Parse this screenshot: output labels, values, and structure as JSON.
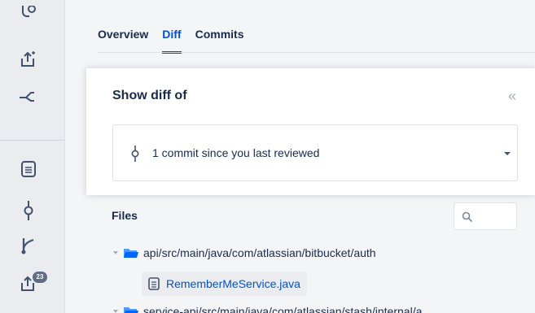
{
  "tabs": [
    {
      "label": "Overview"
    },
    {
      "label": "Diff"
    },
    {
      "label": "Commits"
    }
  ],
  "sidebar": {
    "icons": [
      "pin-icon",
      "share-icon",
      "merge-icon",
      "document-icon",
      "commit-icon",
      "branch-icon",
      "share-badge-icon"
    ],
    "badge_count": "23"
  },
  "diff_popover": {
    "title": "Show diff of",
    "collapse_glyph": "«",
    "selected_option": "1 commit since you last reviewed"
  },
  "files": {
    "label": "Files",
    "tree": [
      {
        "type": "folder",
        "path": "api/src/main/java/com/atlassian/bitbucket/auth"
      },
      {
        "type": "file",
        "name": "RememberMeService.java"
      },
      {
        "type": "folder",
        "path": "service-api/src/main/java/com/atlassian/stash/internal/a"
      }
    ]
  },
  "colors": {
    "accent": "#0052cc",
    "text": "#172b4d",
    "background": "#f4f5f7"
  }
}
